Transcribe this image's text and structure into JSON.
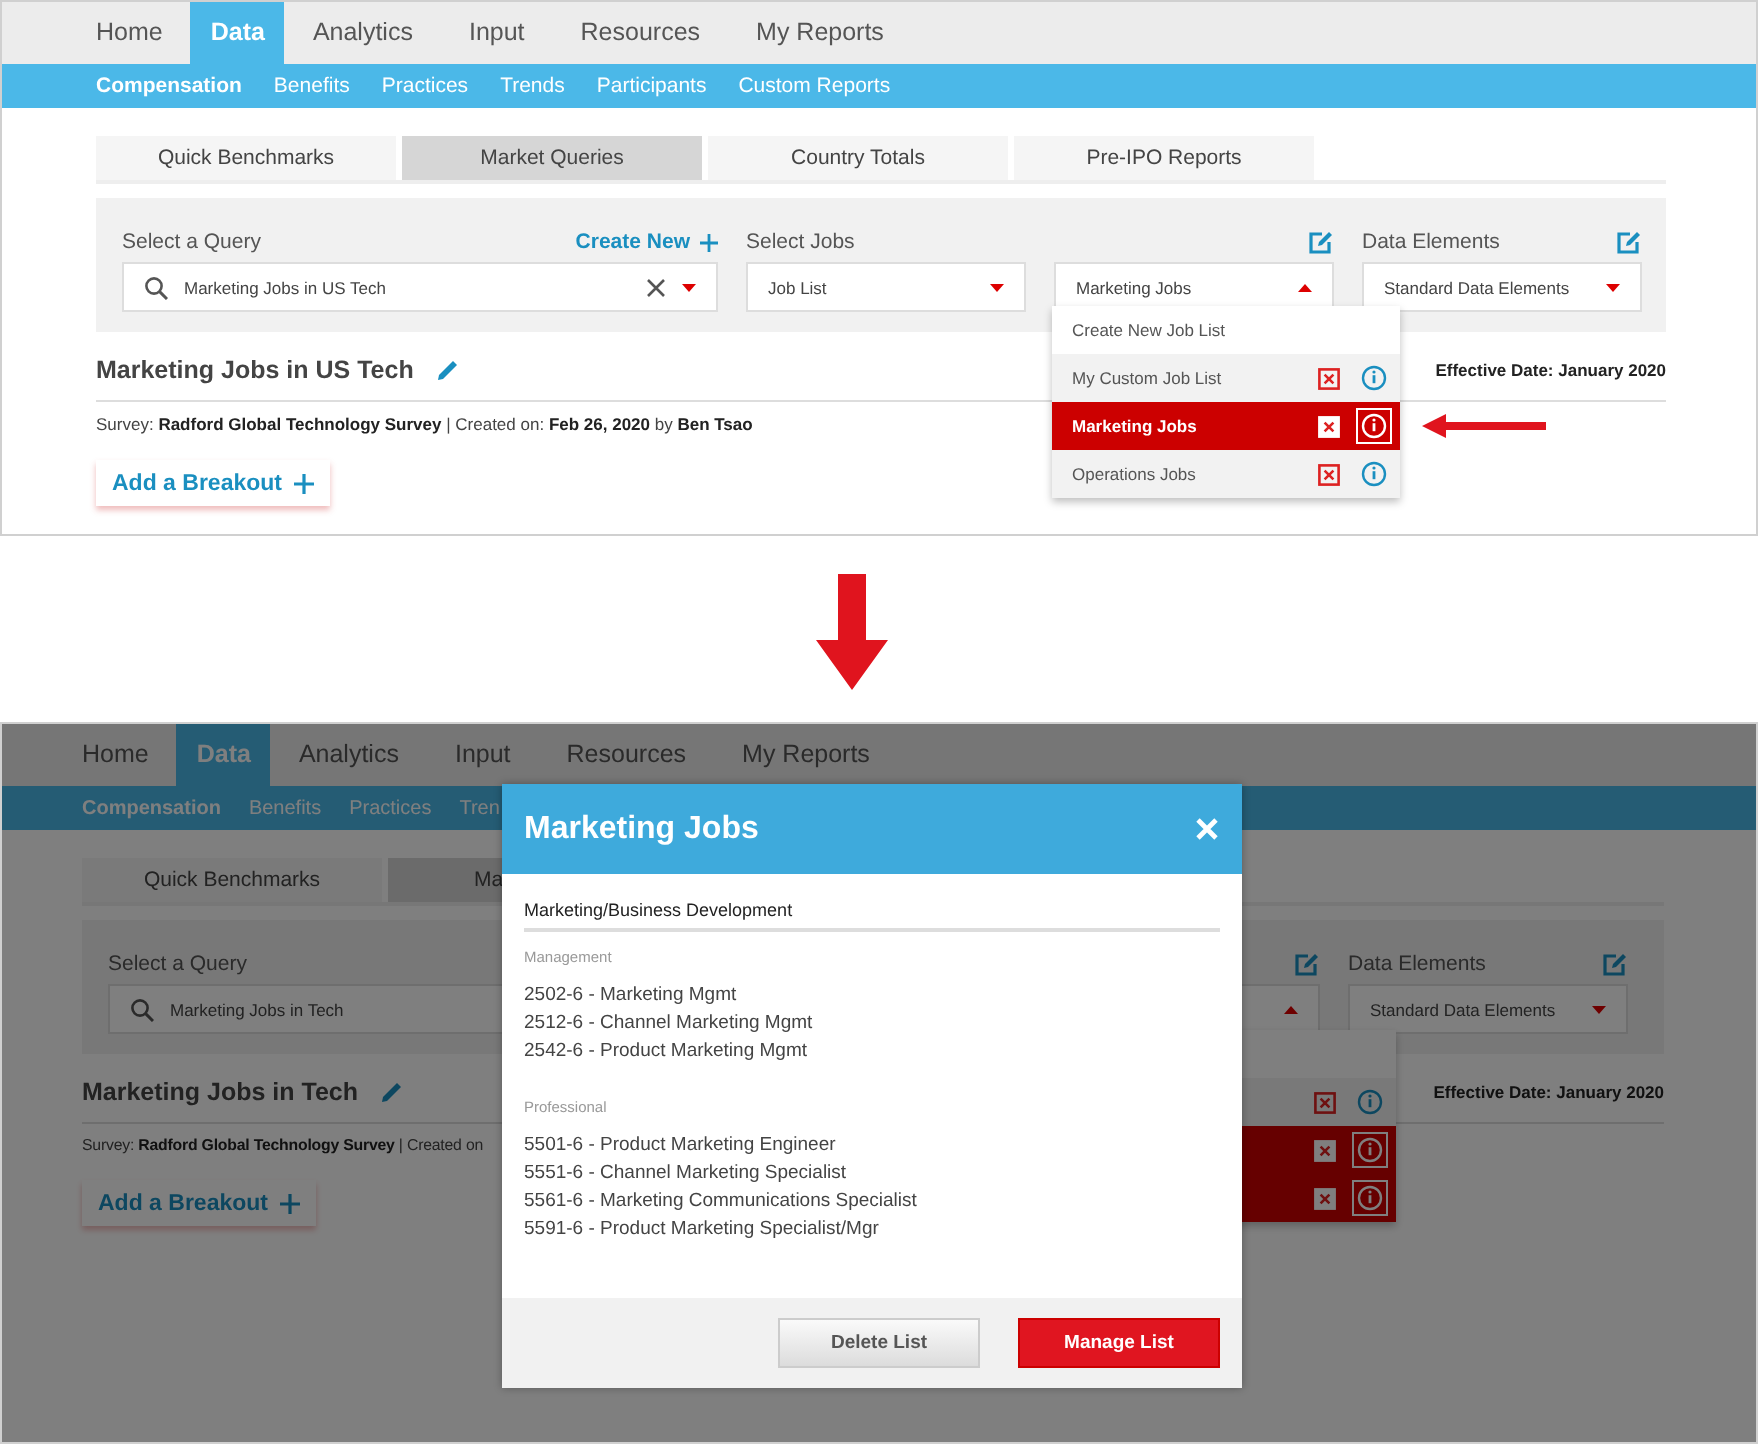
{
  "screens": [
    {
      "nav": [
        {
          "label": "Home",
          "selected": false
        },
        {
          "label": "Data",
          "selected": true
        },
        {
          "label": "Analytics",
          "selected": false
        },
        {
          "label": "Input",
          "selected": false
        },
        {
          "label": "Resources",
          "selected": false
        },
        {
          "label": "My Reports",
          "selected": false
        }
      ],
      "subnav": [
        {
          "label": "Compensation",
          "selected": true
        },
        {
          "label": "Benefits",
          "selected": false
        },
        {
          "label": "Practices",
          "selected": false
        },
        {
          "label": "Trends",
          "selected": false
        },
        {
          "label": "Participants",
          "selected": false
        },
        {
          "label": "Custom Reports",
          "selected": false
        }
      ],
      "tabs": [
        {
          "label": "Quick Benchmarks",
          "selected": false
        },
        {
          "label": "Market Queries",
          "selected": true
        },
        {
          "label": "Country Totals",
          "selected": false
        },
        {
          "label": "Pre-IPO Reports",
          "selected": false
        }
      ],
      "query": {
        "query_label": "Select a Query",
        "create_new": "Create New",
        "search_value": "Marketing Jobs in US Tech",
        "jobs_label": "Select Jobs",
        "job_list_value": "Job List",
        "jobs_value": "Marketing Jobs",
        "jobs_open": true,
        "elements_label": "Data Elements",
        "elements_value": "Standard Data Elements"
      },
      "title": "Marketing Jobs in US Tech",
      "effective_date": "Effective Date: January 2020",
      "survey": "Survey: **Radford Global Technology Survey** | Created on: **Feb 26, 2020** by **Ben Tsao**",
      "breakout": "Add a Breakout",
      "job_menu": [
        {
          "kind": "create",
          "label": "Create New Job List"
        },
        {
          "kind": "list",
          "label": "My Custom Job List",
          "selected": false
        },
        {
          "kind": "list",
          "label": "Marketing Jobs",
          "selected": true
        },
        {
          "kind": "list",
          "label": "Operations Jobs",
          "selected": false
        }
      ]
    },
    {
      "nav": [
        {
          "label": "Home",
          "selected": false
        },
        {
          "label": "Data",
          "selected": true
        },
        {
          "label": "Analytics",
          "selected": false
        },
        {
          "label": "Input",
          "selected": false
        },
        {
          "label": "Resources",
          "selected": false
        },
        {
          "label": "My Reports",
          "selected": false
        }
      ],
      "subnav": [
        {
          "label": "Compensation",
          "selected": true
        },
        {
          "label": "Benefits",
          "selected": false
        },
        {
          "label": "Practices",
          "selected": false
        },
        {
          "label": "Tren",
          "selected": false
        }
      ],
      "tabs": [
        {
          "label": "Quick Benchmarks",
          "selected": false
        },
        {
          "label": "Ma",
          "selected": true
        }
      ],
      "query": {
        "query_label": "Select a Query",
        "search_value": "Marketing Jobs in Tech",
        "jobs_open": true,
        "elements_label": "Data Elements",
        "elements_value": "Standard Data Elements"
      },
      "title": "Marketing Jobs in Tech",
      "effective_date": "Effective Date: January 2020",
      "survey": "Survey: **Radford Global Technology Survey** | Created on",
      "breakout": "Add a Breakout",
      "job_menu": [
        {
          "kind": "create"
        },
        {
          "kind": "list",
          "selected": false
        },
        {
          "kind": "list",
          "selected": true
        },
        {
          "kind": "list",
          "selected": true
        }
      ],
      "modal": {
        "title": "Marketing Jobs",
        "category": "Marketing/Business Development",
        "groups": [
          {
            "name": "Management",
            "jobs": [
              "2502-6 - Marketing Mgmt",
              "2512-6 - Channel Marketing Mgmt",
              "2542-6 - Product Marketing Mgmt"
            ]
          },
          {
            "name": "Professional",
            "jobs": [
              "5501-6 - Product Marketing Engineer",
              "5551-6 - Channel Marketing Specialist",
              "5561-6 - Marketing Communications Specialist",
              "5591-6 - Product Marketing Specialist/Mgr"
            ]
          }
        ],
        "buttons": [
          {
            "kind": "secondary",
            "label": "Delete List"
          },
          {
            "kind": "primary",
            "label": "Manage List"
          }
        ]
      }
    }
  ]
}
